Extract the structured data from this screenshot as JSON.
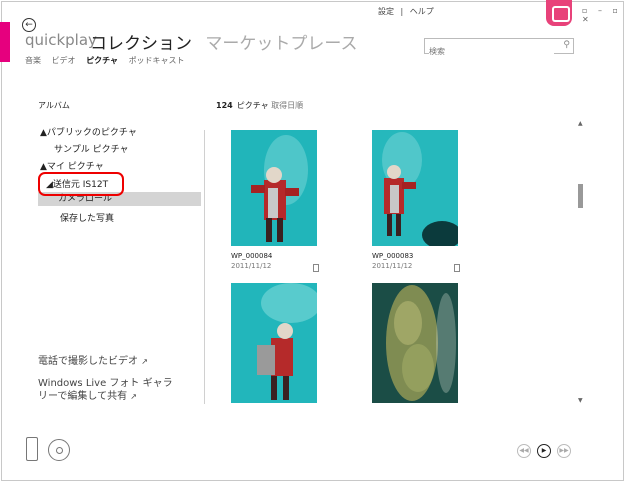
{
  "titlebar": {
    "settings": "設定",
    "help": "ヘルプ"
  },
  "header": {
    "brand": "quickplay",
    "collection": "コレクション",
    "marketplace": "マーケットプレース",
    "subtabs": [
      "音楽",
      "ビデオ",
      "ピクチャ",
      "ポッドキャスト"
    ]
  },
  "search": {
    "placeholder": "検索"
  },
  "sidebar": {
    "title": "アルバム",
    "items": [
      "▲パブリックのピクチャ",
      "サンプル ピクチャ",
      "▲マイ ピクチャ",
      "◢送信元 IS12T",
      "カメラロール",
      "保存した写真"
    ],
    "links": [
      "電話で撮影したビデオ",
      "Windows Live フォト ギャラ",
      "リーで編集して共有"
    ]
  },
  "content": {
    "count": "124",
    "count_label": "ピクチャ",
    "sort_label": "取得日順",
    "photos": [
      {
        "name": "WP_000084",
        "date": "2011/11/12"
      },
      {
        "name": "WP_000083",
        "date": "2011/11/12"
      }
    ]
  },
  "colors": {
    "accent": "#e8427a",
    "stripe": "#e6007e",
    "highlight_ring": "#ee0000",
    "water": "#1fb3b8"
  },
  "icons": [
    "back-arrow-icon",
    "app-logo-icon",
    "search-icon",
    "phone-icon",
    "disc-icon",
    "previous-icon",
    "play-icon",
    "next-icon"
  ]
}
